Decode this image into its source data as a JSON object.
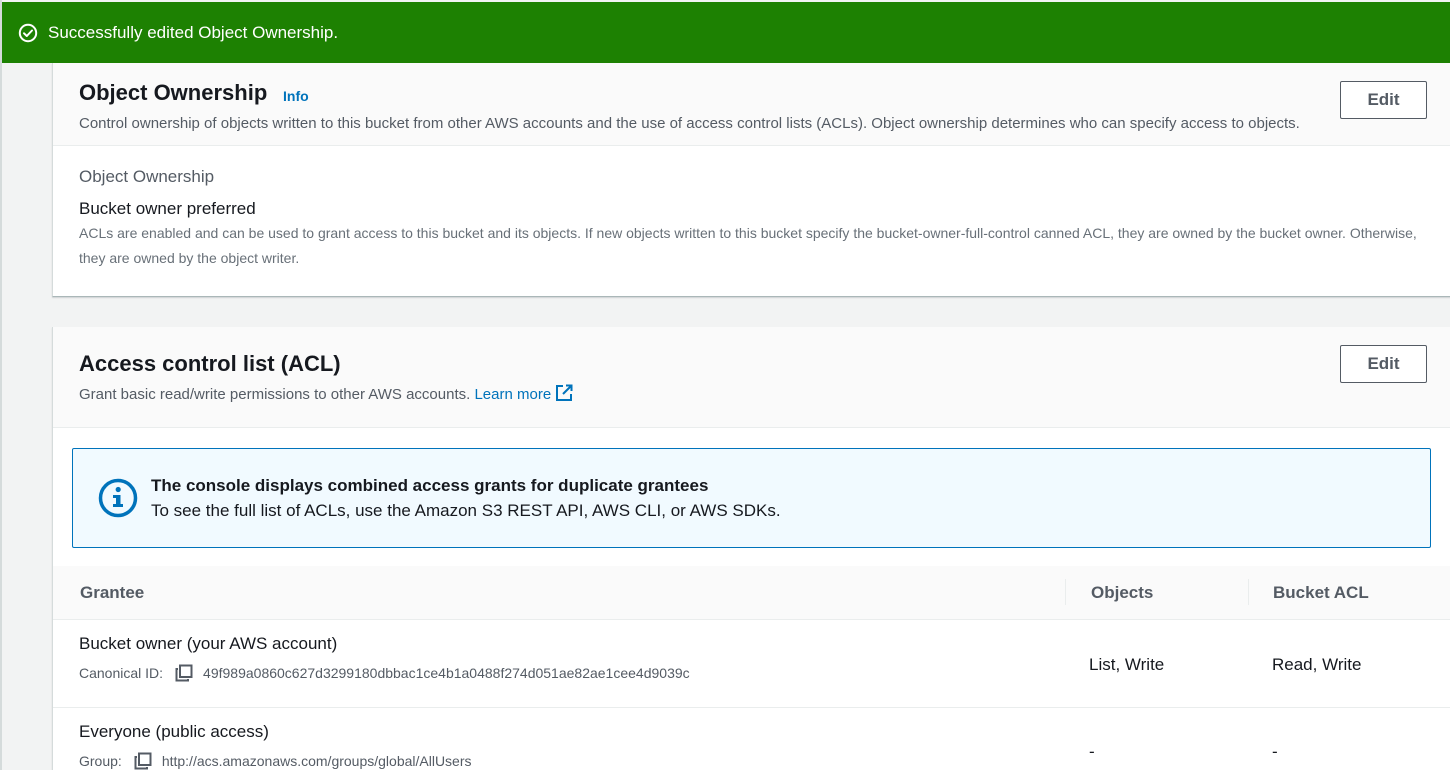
{
  "flash": {
    "message": "Successfully edited Object Ownership.",
    "icon": "check-circle-icon",
    "color": "#1d8102"
  },
  "object_ownership": {
    "title": "Object Ownership",
    "info_label": "Info",
    "description": "Control ownership of objects written to this bucket from other AWS accounts and the use of access control lists (ACLs). Object ownership determines who can specify access to objects.",
    "edit_label": "Edit",
    "field_label": "Object Ownership",
    "field_value": "Bucket owner preferred",
    "field_description": "ACLs are enabled and can be used to grant access to this bucket and its objects. If new objects written to this bucket specify the bucket-owner-full-control canned ACL, they are owned by the bucket owner. Otherwise, they are owned by the object writer."
  },
  "acl": {
    "title": "Access control list (ACL)",
    "description": "Grant basic read/write permissions to other AWS accounts.",
    "learn_more": "Learn more",
    "edit_label": "Edit",
    "alert": {
      "title": "The console displays combined access grants for duplicate grantees",
      "body": "To see the full list of ACLs, use the Amazon S3 REST API, AWS CLI, or AWS SDKs.",
      "icon": "info-circle-icon"
    },
    "columns": [
      "Grantee",
      "Objects",
      "Bucket ACL"
    ],
    "rows": [
      {
        "grantee": "Bucket owner (your AWS account)",
        "id_label": "Canonical ID:",
        "id_value": "49f989a0860c627d3299180dbbac1ce4b1a0488f274d051ae82ae1cee4d9039c",
        "objects": "List, Write",
        "bucket_acl": "Read, Write"
      },
      {
        "grantee": "Everyone (public access)",
        "id_label": "Group:",
        "id_value": "http://acs.amazonaws.com/groups/global/AllUsers",
        "objects": "-",
        "bucket_acl": "-"
      }
    ]
  }
}
